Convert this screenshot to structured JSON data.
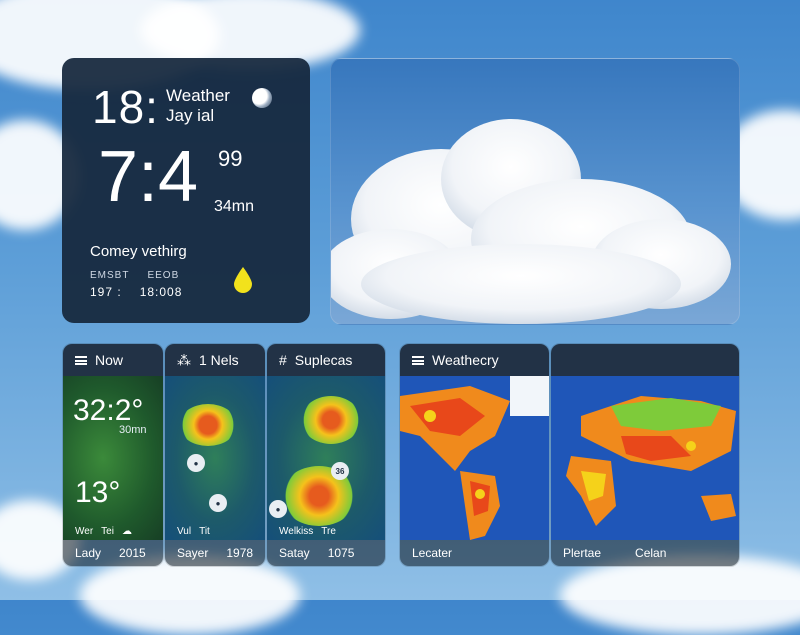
{
  "main_card": {
    "time_small": "18:",
    "title_line1": "Weather",
    "title_line2": "Jay ial",
    "time_large": "7:4",
    "time_sup": "99",
    "time_unit": "34mn",
    "description": "Comey vethirg",
    "meta_labels": [
      "EMSBT",
      "EEOB"
    ],
    "meta_values": [
      "197 :",
      "18:008"
    ],
    "icons": {
      "moon": "moon-icon",
      "drop": "raindrop-icon"
    },
    "accent_color": "#f2e21c"
  },
  "widgets": [
    {
      "header": "Now",
      "header_icon": "menu-icon",
      "temp_top": "32:2°",
      "temp_top_sub": "30mn",
      "temp_bottom": "13°",
      "mini_row": [
        "Wer",
        "Tei"
      ],
      "footer": [
        "Lady",
        "2015"
      ]
    },
    {
      "header": "1 Nels",
      "header_icon": "share-icon",
      "mini_row": [
        "Vul",
        "Tit"
      ],
      "footer": [
        "Sayer",
        "1978"
      ]
    },
    {
      "header": "Suplecas",
      "header_icon": "hash-icon",
      "badge": "36",
      "mini_row": [
        "Welkiss",
        "Tre"
      ],
      "footer": [
        "Satay",
        "1075"
      ]
    },
    {
      "header": "Weathecry",
      "header_icon": "menu-icon",
      "footer": [
        "Lecater"
      ]
    },
    {
      "header": "",
      "footer": [
        "Plertae",
        "Celan"
      ]
    }
  ]
}
